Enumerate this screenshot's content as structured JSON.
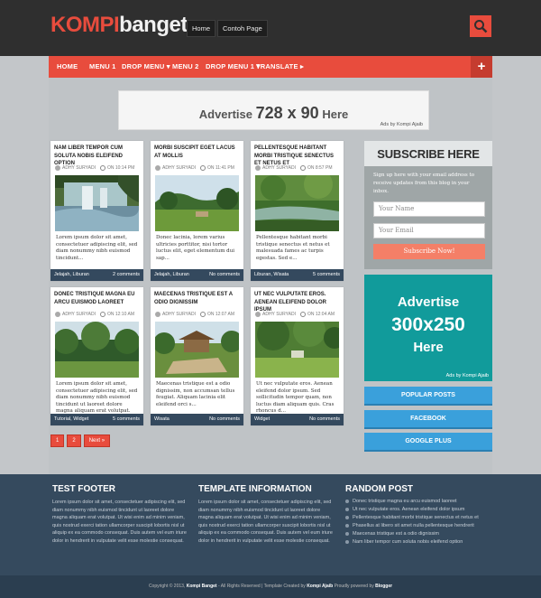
{
  "header": {
    "logo_part1": "KOMPI",
    "logo_part2": "banget",
    "top_links": [
      "Home",
      "Contoh Page"
    ],
    "accent": "#e84c3d"
  },
  "nav": {
    "items": [
      "HOME",
      "MENU 1",
      "DROP MENU ▾",
      "MENU 2",
      "DROP MENU 1 ▾",
      "TRANSLATE ▸"
    ],
    "plus": "+"
  },
  "ad_banner": {
    "text": "Advertise",
    "size": "728 x 90",
    "here": "Here",
    "by": "Ads by Kompi Ajaib"
  },
  "posts": [
    {
      "title": "NAM LIBER TEMPOR CUM SOLUTA NOBIS ELEIFEND OPTION",
      "author": "ADHY SURYADI",
      "time": "ON 10:14 PM",
      "snippet": "Lorem ipsum dolor sit amet, consectetuer adipiscing elit, sed diam nonummy nibh euismod tincidunt...",
      "labels": "Jelajah, Liburan",
      "comments": "2 comments"
    },
    {
      "title": "MORBI SUSCIPIT EGET LACUS AT MOLLIS",
      "author": "ADHY SURYADI",
      "time": "ON 11:41 PM",
      "snippet": "Donec lacinia, lorem varius ultricies porttitor, nisi tortor luctus elit, eget elementum dui sap...",
      "labels": "Jelajah, Liburan",
      "comments": "No comments"
    },
    {
      "title": "PELLENTESQUE HABITANT MORBI TRISTIQUE SENECTUS ET NETUS ET",
      "author": "ADHY SURYADI",
      "time": "ON 8:57 PM",
      "snippet": "Pellentesque habitant morbi tristique senectus et netus et malesuada fames ac turpis egestas. Sed e...",
      "labels": "Liburan, Wisata",
      "comments": "5 comments"
    },
    {
      "title": "DONEC TRISTIQUE MAGNA EU ARCU EUISMOD LAOREET",
      "author": "ADHY SURYADI",
      "time": "ON 12:10 AM",
      "snippet": "Lorem ipsum dolor sit amet, consectetuer adipiscing elit, sed diam nonummy nibh euismod tincidunt ut laoreet dolore magna aliquam erat volutpat. D...",
      "labels": "Tutorial, Widget",
      "comments": "5 comments"
    },
    {
      "title": "MAECENAS TRISTIQUE EST A ODIO DIGNISSIM",
      "author": "ADHY SURYADI",
      "time": "ON 12:07 AM",
      "snippet": "Maecenas tristique est a odio dignissim, non accumsan tellus feugiat. Aliquam lacinia elit eleifend orci s...",
      "labels": "Wisata",
      "comments": "No comments"
    },
    {
      "title": "UT NEC VULPUTATE EROS. AENEAN ELEIFEND DOLOR IPSUM",
      "author": "ADHY SURYADI",
      "time": "ON 12:04 AM",
      "snippet": "Ut nec vulputate eros. Aenean eleifend dolor ipsum. Sed sollicitudin tempor quam, non luctus diam aliquam quis. Cras rhoncus d...",
      "labels": "Widget",
      "comments": "No comments"
    }
  ],
  "pager": [
    "1",
    "2",
    "Next »"
  ],
  "subscribe": {
    "title": "SUBSCRIBE HERE",
    "desc": "Sign up here with your email address to receive updates from this blog in your inbox.",
    "name_placeholder": "Your Name",
    "email_placeholder": "Your Email",
    "button": "Subscribe Now!"
  },
  "ad_box": {
    "line1": "Advertise",
    "line2": "300x250",
    "line3": "Here",
    "by": "Ads by Kompi Ajaib",
    "color": "#119b9b"
  },
  "side_buttons": [
    "POPULAR POSTS",
    "FACEBOOK",
    "GOOGLE PLUS"
  ],
  "footer": {
    "col1_title": "TEST FOOTER",
    "col1_text": "Lorem ipsum dolor sit amet, consectetuer adipiscing elit, sed diam nonummy nibh euismod tincidunt ut laoreet dolore magna aliquam erat volutpat. Ut wisi enim ad minim veniam, quis nostrud exerci tation ullamcorper suscipit lobortis nisl ut aliquip ex ea commodo consequat. Duis autem vel eum iriure dolor in hendrerit in vulputate velit esse molestie consequat.",
    "col2_title": "TEMPLATE INFORMATION",
    "col2_text": "Lorem ipsum dolor sit amet, consectetuer adipiscing elit, sed diam nonummy nibh euismod tincidunt ut laoreet dolore magna aliquam erat volutpat. Ut wisi enim ad minim veniam, quis nostrud exerci tation ullamcorper suscipit lobortis nisl ut aliquip ex ea commodo consequat. Duis autem vel eum iriure dolor in hendrerit in vulputate velit esse molestie consequat.",
    "col3_title": "RANDOM POST",
    "random_posts": [
      "Donec tristique magna eu arcu euismod laoreet",
      "Ut nec vulputate eros. Aenean eleifend dolor ipsum",
      "Pellentesque habitant morbi tristique senectus et netus et",
      "Phasellus at libero sit amet nulla pellentesque hendrerit",
      "Maecenas tristique est a odio dignissim",
      "Nam liber tempor cum soluta nobis eleifend option"
    ]
  },
  "copyright": {
    "pre": "Copyright © 2013,",
    "site": "Kompi Banget",
    "mid": "- All Rights Reserved | Template Created by",
    "author": "Kompi Ajaib",
    "powered": "Proudly powered by",
    "platform": "Blogger"
  }
}
